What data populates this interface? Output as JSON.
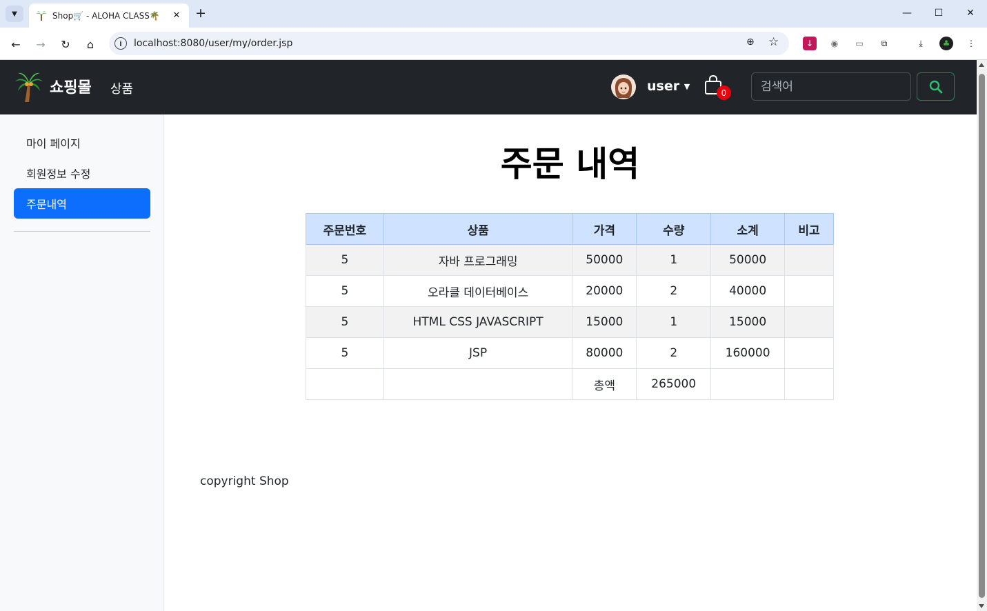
{
  "browser": {
    "tab_title": "Shop🛒 - ALOHA CLASS🌴",
    "new_tab_symbol": "+",
    "url": "localhost:8080/user/my/order.jsp"
  },
  "navbar": {
    "brand": "쇼핑몰",
    "nav_link": "상품",
    "user_label": "user",
    "cart_count": "0",
    "search_placeholder": "검색어"
  },
  "sidebar": {
    "items": [
      {
        "label": "마이 페이지",
        "active": false
      },
      {
        "label": "회원정보 수정",
        "active": false
      },
      {
        "label": "주문내역",
        "active": true
      }
    ]
  },
  "main": {
    "title": "주문 내역",
    "table": {
      "headers": [
        "주문번호",
        "상품",
        "가격",
        "수량",
        "소계",
        "비고"
      ],
      "rows": [
        [
          "5",
          "자바 프로그래밍",
          "50000",
          "1",
          "50000",
          ""
        ],
        [
          "5",
          "오라클 데이터베이스",
          "20000",
          "2",
          "40000",
          ""
        ],
        [
          "5",
          "HTML CSS JAVASCRIPT",
          "15000",
          "1",
          "15000",
          ""
        ],
        [
          "5",
          "JSP",
          "80000",
          "2",
          "160000",
          ""
        ]
      ],
      "total_label": "총액",
      "total_value": "265000"
    }
  },
  "footer": {
    "copyright": "copyright Shop"
  },
  "colors": {
    "navbar_bg": "#212529",
    "active_item": "#0d6efd",
    "table_header": "#cfe2ff",
    "search_button": "#198754",
    "badge": "#e8000f"
  },
  "icons": [
    "tab-search-icon",
    "back-icon",
    "forward-icon",
    "reload-icon",
    "home-icon",
    "site-info-icon",
    "zoom-icon",
    "bookmark-star-icon",
    "extensions-icon",
    "download-icon",
    "palm-tree-logo-icon",
    "cart-icon",
    "search-icon"
  ]
}
